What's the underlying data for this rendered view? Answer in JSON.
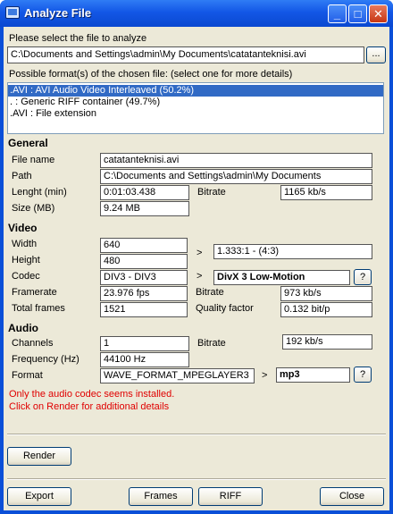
{
  "window": {
    "title": "Analyze File",
    "buttons": {
      "minimize": "_",
      "maximize": "□",
      "close": "✕"
    }
  },
  "file": {
    "prompt": "Please select the file to analyze",
    "path_value": "C:\\Documents and Settings\\admin\\My Documents\\catatanteknisi.avi",
    "browse_label": "..."
  },
  "formats": {
    "label": "Possible format(s) of the chosen file: (select one for more details)",
    "items": [
      ".AVI : AVI Audio Video Interleaved (50.2%)",
      ". : Generic RIFF container (49.7%)",
      ".AVI : File extension"
    ],
    "selected_index": 0
  },
  "general": {
    "heading": "General",
    "file_name_label": "File name",
    "file_name": "catatanteknisi.avi",
    "path_label": "Path",
    "path": "C:\\Documents and Settings\\admin\\My Documents",
    "length_label": "Lenght (min)",
    "length": "0:01:03.438",
    "bitrate_label": "Bitrate",
    "bitrate": "1165 kb/s",
    "size_label": "Size (MB)",
    "size": "9.24 MB"
  },
  "video": {
    "heading": "Video",
    "width_label": "Width",
    "width": "640",
    "height_label": "Height",
    "height": "480",
    "aspect_arrow": ">",
    "aspect": "1.333:1 - (4:3)",
    "codec_label": "Codec",
    "codec": "DIV3 - DIV3",
    "codec_arrow": ">",
    "codec_name": "DivX 3 Low-Motion",
    "codec_help": "?",
    "framerate_label": "Framerate",
    "framerate": "23.976 fps",
    "bitrate_label": "Bitrate",
    "bitrate": "973 kb/s",
    "total_frames_label": "Total frames",
    "total_frames": "1521",
    "quality_label": "Quality factor",
    "quality": "0.132 bit/p"
  },
  "audio": {
    "heading": "Audio",
    "channels_label": "Channels",
    "channels": "1",
    "bitrate_label": "Bitrate",
    "bitrate": "192 kb/s",
    "frequency_label": "Frequency (Hz)",
    "frequency": "44100 Hz",
    "format_label": "Format",
    "format": "WAVE_FORMAT_MPEGLAYER3",
    "format_arrow": ">",
    "format_name": "mp3",
    "format_help": "?"
  },
  "messages": {
    "line1": "Only the audio codec seems installed.",
    "line2": "Click on Render for additional details"
  },
  "buttons": {
    "render": "Render",
    "export": "Export",
    "frames": "Frames",
    "riff": "RIFF",
    "close": "Close"
  }
}
